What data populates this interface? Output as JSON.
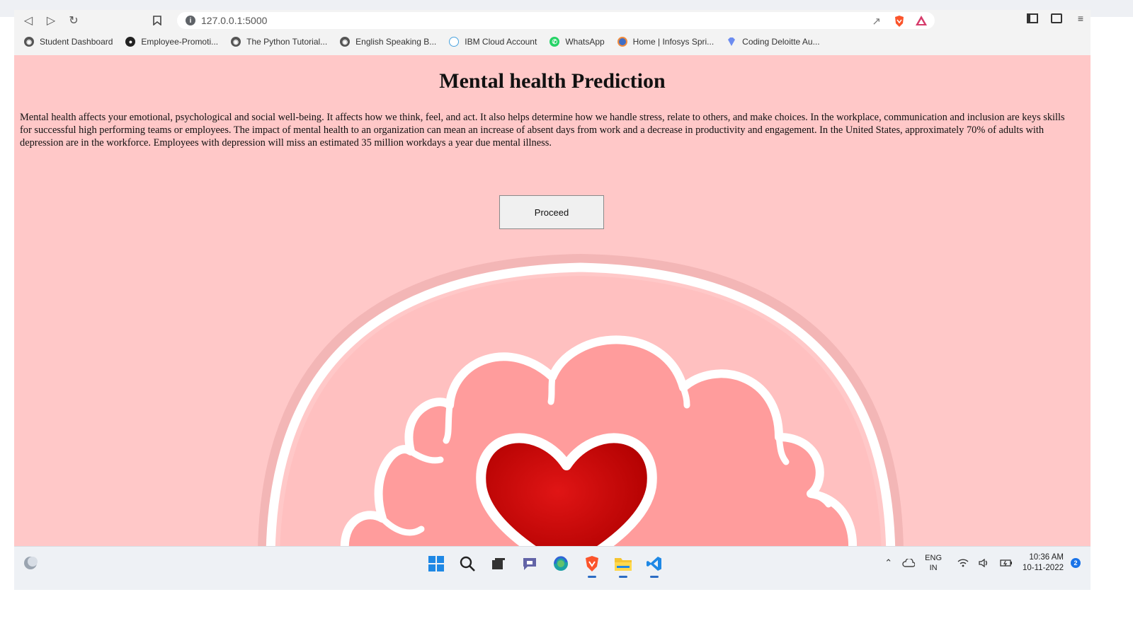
{
  "browser": {
    "url": "127.0.0.1:5000",
    "bookmarks": [
      {
        "label": "Student Dashboard",
        "icon": "globe-icon"
      },
      {
        "label": "Employee-Promoti...",
        "icon": "github-icon"
      },
      {
        "label": "The Python Tutorial...",
        "icon": "globe-icon"
      },
      {
        "label": "English Speaking B...",
        "icon": "globe-icon"
      },
      {
        "label": "IBM Cloud Account",
        "icon": "cloud-icon"
      },
      {
        "label": "WhatsApp",
        "icon": "whatsapp-icon"
      },
      {
        "label": "Home | Infosys Spri...",
        "icon": "infosys-icon"
      },
      {
        "label": "Coding Deloitte Au...",
        "icon": "diamond-icon"
      }
    ]
  },
  "page": {
    "title": "Mental health Prediction",
    "description": "Mental health affects your emotional, psychological and social well-being. It affects how we think, feel, and act. It also helps determine how we handle stress, relate to others, and make choices. In the workplace, communication and inclusion are keys skills for successful high performing teams or employees. The impact of mental health to an organization can mean an increase of absent days from work and a decrease in productivity and engagement. In the United States, approximately 70% of adults with depression are in the workforce. Employees with depression will miss an estimated 35 million workdays a year due mental illness.",
    "proceed_label": "Proceed",
    "background_color": "#ffc8c8"
  },
  "taskbar": {
    "language_line1": "ENG",
    "language_line2": "IN",
    "time": "10:36 AM",
    "date": "10-11-2022",
    "notification_count": "2"
  }
}
